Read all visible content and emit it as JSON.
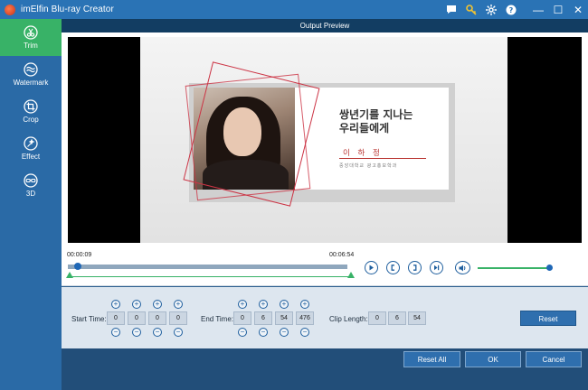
{
  "window": {
    "title": "imElfin Blu-ray Creator",
    "icons": [
      "chat-icon",
      "key-icon",
      "gear-icon",
      "help-icon"
    ],
    "minimize": "—",
    "restore": "☐",
    "close": "✕"
  },
  "sidebar": {
    "items": [
      {
        "label": "Trim",
        "icon": "scissors-icon",
        "active": true
      },
      {
        "label": "Watermark",
        "icon": "watermark-icon",
        "active": false
      },
      {
        "label": "Crop",
        "icon": "crop-icon",
        "active": false
      },
      {
        "label": "Effect",
        "icon": "effect-icon",
        "active": false
      },
      {
        "label": "3D",
        "icon": "3d-glasses-icon",
        "active": false
      }
    ]
  },
  "preview": {
    "header": "Output Preview",
    "video_headline_1": "쌍년기를 지나는",
    "video_headline_2": "우리들에게",
    "video_name": "이 하 정",
    "video_affiliation": "중앙대학교 광고홍보학과"
  },
  "timeline": {
    "start_time": "00:00:09",
    "end_time": "00:06:54",
    "controls": [
      "play-icon",
      "mark-in-icon",
      "mark-out-icon",
      "next-frame-icon"
    ],
    "volume_icon": "volume-icon"
  },
  "trim": {
    "start_label": "Start Time:",
    "start_values": [
      "0",
      "0",
      "0",
      "0"
    ],
    "end_label": "End Time:",
    "end_values": [
      "0",
      "6",
      "54",
      "476"
    ],
    "clip_label": "Clip Length:",
    "clip_values": [
      "0",
      "6",
      "54"
    ],
    "plus": "+",
    "minus": "−",
    "reset_label": "Reset"
  },
  "footer": {
    "reset_all": "Reset All",
    "ok": "OK",
    "cancel": "Cancel"
  },
  "colors": {
    "titlebar": "#2a73b5",
    "sidebar": "#2a6aa6",
    "active_tab": "#38b267",
    "preview_header": "#123d62",
    "button": "#2f6fae"
  }
}
